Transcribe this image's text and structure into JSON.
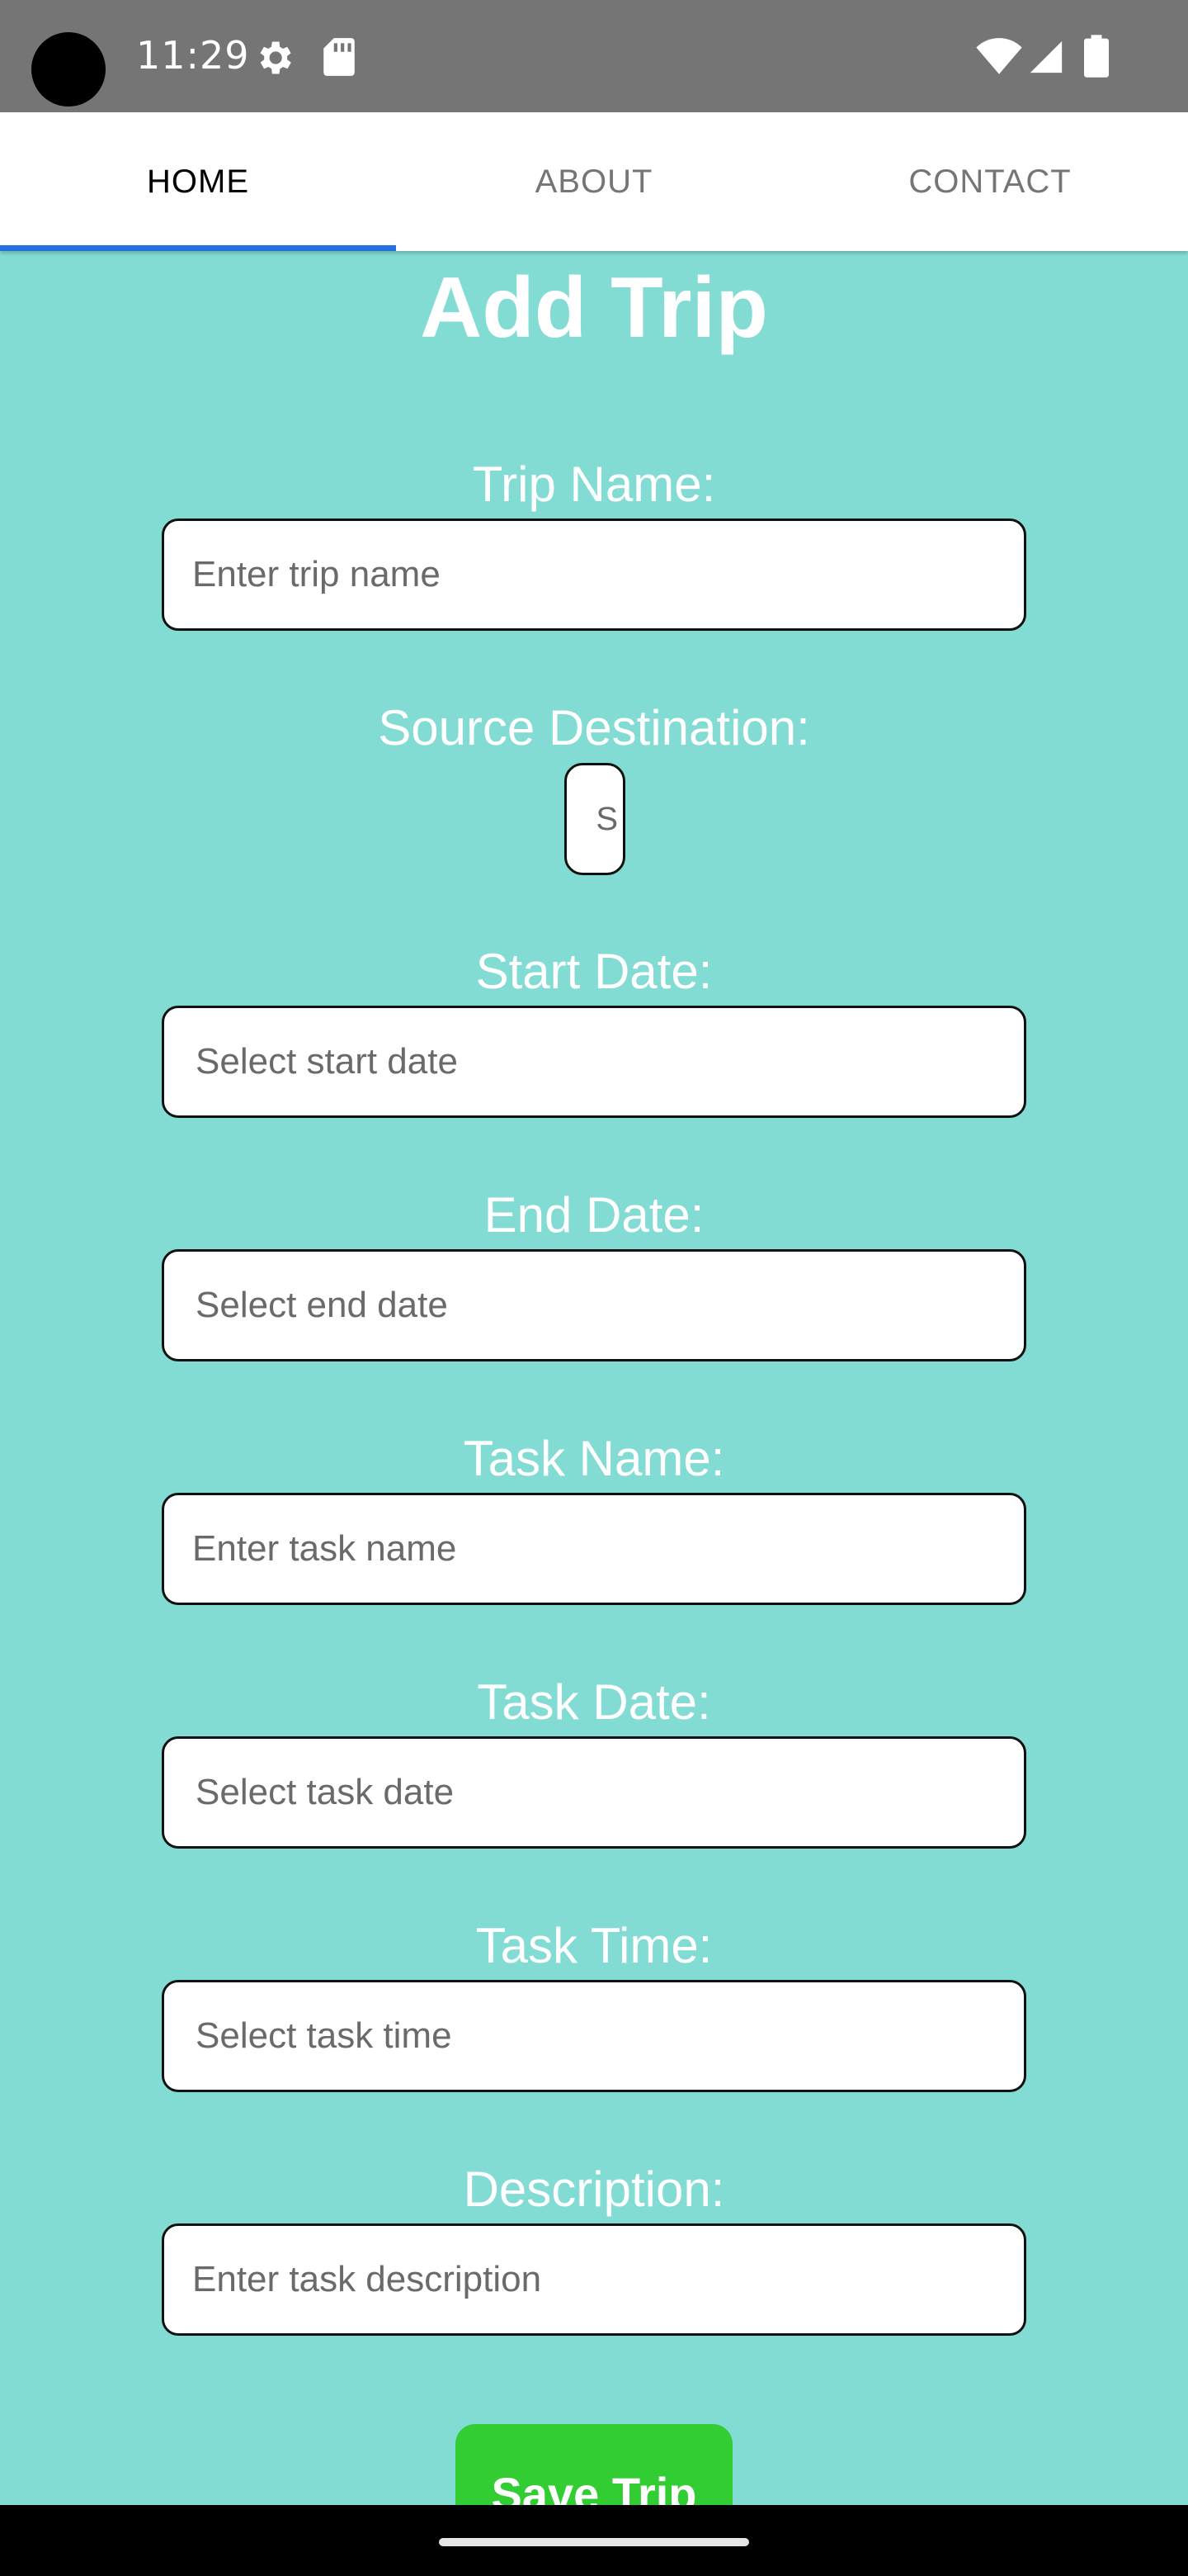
{
  "status_bar": {
    "time": "11:29",
    "icons": [
      "camera-cutout",
      "gear-icon",
      "sd-card-icon",
      "wifi-icon",
      "cell-signal-icon",
      "battery-icon"
    ]
  },
  "tabs": [
    {
      "label": "HOME",
      "active": true
    },
    {
      "label": "ABOUT",
      "active": false
    },
    {
      "label": "CONTACT",
      "active": false
    }
  ],
  "colors": {
    "background": "#82dcd3",
    "tab_indicator": "#2370e0",
    "save_button": "#32cd32",
    "status_bar": "#757575"
  },
  "form": {
    "title": "Add Trip",
    "trip_name": {
      "label": "Trip Name:",
      "placeholder": "Enter trip name"
    },
    "source_destination": {
      "label": "Source Destination:",
      "visible_text": "S"
    },
    "start_date": {
      "label": "Start Date:",
      "placeholder": "Select start date"
    },
    "end_date": {
      "label": "End Date:",
      "placeholder": "Select end date"
    },
    "task_name": {
      "label": "Task Name:",
      "placeholder": "Enter task name"
    },
    "task_date": {
      "label": "Task Date:",
      "placeholder": "Select task date"
    },
    "task_time": {
      "label": "Task Time:",
      "placeholder": "Select task time"
    },
    "description": {
      "label": "Description:",
      "placeholder": "Enter task description"
    },
    "save_label": "Save Trip"
  }
}
